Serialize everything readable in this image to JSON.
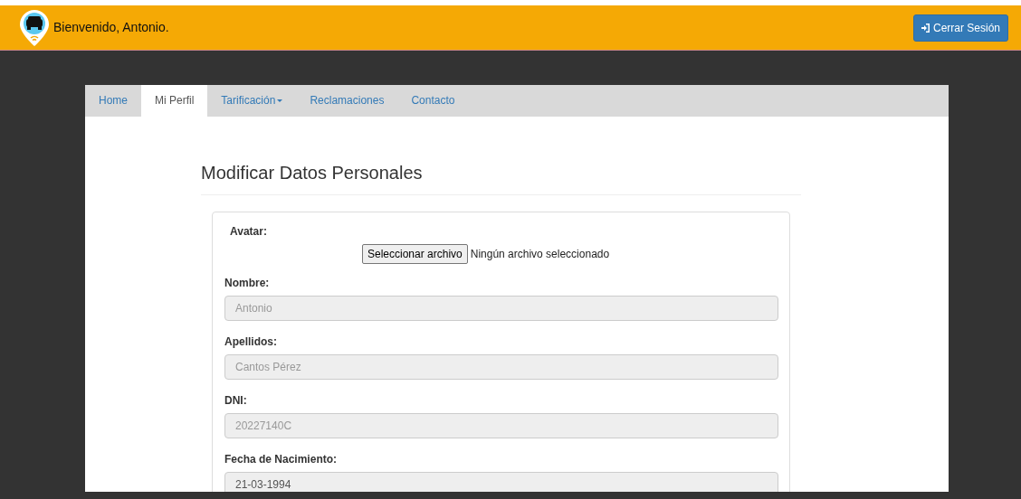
{
  "header": {
    "greeting": "Bienvenido, Antonio.",
    "logout_button": "Cerrar Sesión"
  },
  "tabs": [
    {
      "label": "Home",
      "selected": false,
      "dropdown": false
    },
    {
      "label": "Mi Perfil",
      "selected": true,
      "dropdown": false
    },
    {
      "label": "Tarificación",
      "selected": false,
      "dropdown": true
    },
    {
      "label": "Reclamaciones",
      "selected": false,
      "dropdown": false
    },
    {
      "label": "Contacto",
      "selected": false,
      "dropdown": false
    }
  ],
  "page_title": "Modificar Datos Personales",
  "avatar": {
    "label": "Avatar:",
    "button": "Seleccionar archivo",
    "status": "Ningún archivo seleccionado"
  },
  "fields": [
    {
      "label": "Nombre:",
      "value": "Antonio",
      "disabled": true
    },
    {
      "label": "Apellidos:",
      "value": "Cantos Pérez",
      "disabled": true
    },
    {
      "label": "DNI:",
      "value": "20227140C",
      "disabled": true
    },
    {
      "label": "Fecha de Nacimiento:",
      "value": "21-03-1994",
      "disabled": false
    }
  ]
}
